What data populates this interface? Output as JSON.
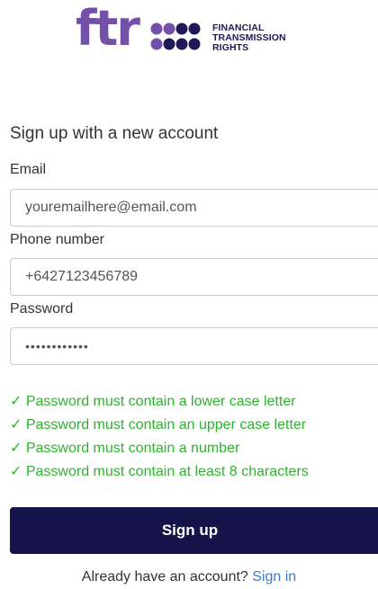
{
  "brand": {
    "wordmark": "ftr",
    "name_lines": [
      "FINANCIAL",
      "TRANSMISSION",
      "RIGHTS"
    ],
    "wordmark_color": "#7451a8",
    "dots_colors": [
      "#7451a8",
      "#1f1a57"
    ],
    "text_color": "#1f1a57"
  },
  "form": {
    "heading": "Sign up with a new account",
    "email": {
      "label": "Email",
      "value": "youremailhere@email.com"
    },
    "phone": {
      "label": "Phone number",
      "value": "+6427123456789"
    },
    "password": {
      "label": "Password",
      "value": "••••••••••••"
    },
    "requirements": [
      "✓ Password must contain a lower case letter",
      "✓ Password must contain an upper case letter",
      "✓ Password must contain a number",
      "✓ Password must contain at least 8 characters"
    ],
    "requirement_color": "#2db32d",
    "submit_label": "Sign up",
    "submit_color": "#15144a"
  },
  "footer": {
    "prompt": "Already have an account?",
    "link": "Sign in"
  }
}
